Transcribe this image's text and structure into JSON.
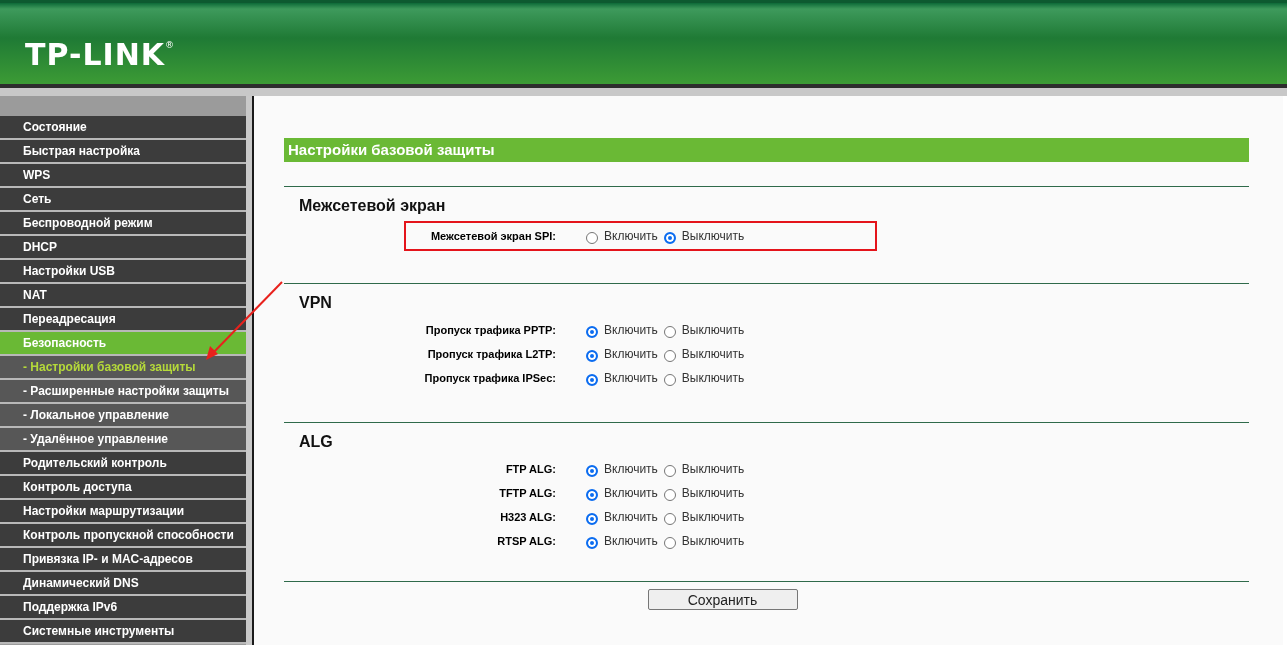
{
  "header": {
    "logo": "TP-LINK",
    "registered_mark": "®"
  },
  "sidebar": {
    "items": [
      {
        "label": "Состояние",
        "selected": false
      },
      {
        "label": "Быстрая настройка",
        "selected": false
      },
      {
        "label": "WPS",
        "selected": false
      },
      {
        "label": "Сеть",
        "selected": false
      },
      {
        "label": "Беспроводной режим",
        "selected": false
      },
      {
        "label": "DHCP",
        "selected": false
      },
      {
        "label": "Настройки USB",
        "selected": false
      },
      {
        "label": "NAT",
        "selected": false
      },
      {
        "label": "Переадресация",
        "selected": false
      },
      {
        "label": "Безопасность",
        "selected": true,
        "children": [
          {
            "label": "- Настройки базовой защиты",
            "selected": true
          },
          {
            "label": "- Расширенные настройки защиты",
            "selected": false
          },
          {
            "label": "- Локальное управление",
            "selected": false
          },
          {
            "label": "- Удалённое управление",
            "selected": false
          }
        ]
      },
      {
        "label": "Родительский контроль",
        "selected": false
      },
      {
        "label": "Контроль доступа",
        "selected": false
      },
      {
        "label": "Настройки маршрутизации",
        "selected": false
      },
      {
        "label": "Контроль пропускной способности",
        "selected": false
      },
      {
        "label": "Привязка IP- и MAC-адресов",
        "selected": false
      },
      {
        "label": "Динамический DNS",
        "selected": false
      },
      {
        "label": "Поддержка IPv6",
        "selected": false
      },
      {
        "label": "Системные инструменты",
        "selected": false
      }
    ]
  },
  "page_title": "Настройки базовой защиты",
  "sections": [
    {
      "title": "Межсетевой экран",
      "rows": [
        {
          "label": "Межсетевой экран SPI:",
          "highlighted": true,
          "options": [
            {
              "label": "Включить",
              "selected": false
            },
            {
              "label": "Выключить",
              "selected": true
            }
          ]
        }
      ]
    },
    {
      "title": "VPN",
      "rows": [
        {
          "label": "Пропуск трафика PPTP:",
          "highlighted": false,
          "options": [
            {
              "label": "Включить",
              "selected": true
            },
            {
              "label": "Выключить",
              "selected": false
            }
          ]
        },
        {
          "label": "Пропуск трафика L2TP:",
          "highlighted": false,
          "options": [
            {
              "label": "Включить",
              "selected": true
            },
            {
              "label": "Выключить",
              "selected": false
            }
          ]
        },
        {
          "label": "Пропуск трафика IPSec:",
          "highlighted": false,
          "options": [
            {
              "label": "Включить",
              "selected": true
            },
            {
              "label": "Выключить",
              "selected": false
            }
          ]
        }
      ]
    },
    {
      "title": "ALG",
      "rows": [
        {
          "label": "FTP ALG:",
          "highlighted": false,
          "options": [
            {
              "label": "Включить",
              "selected": true
            },
            {
              "label": "Выключить",
              "selected": false
            }
          ]
        },
        {
          "label": "TFTP ALG:",
          "highlighted": false,
          "options": [
            {
              "label": "Включить",
              "selected": true
            },
            {
              "label": "Выключить",
              "selected": false
            }
          ]
        },
        {
          "label": "H323 ALG:",
          "highlighted": false,
          "options": [
            {
              "label": "Включить",
              "selected": true
            },
            {
              "label": "Выключить",
              "selected": false
            }
          ]
        },
        {
          "label": "RTSP ALG:",
          "highlighted": false,
          "options": [
            {
              "label": "Включить",
              "selected": true
            },
            {
              "label": "Выключить",
              "selected": false
            }
          ]
        }
      ]
    }
  ],
  "save_button": "Сохранить"
}
